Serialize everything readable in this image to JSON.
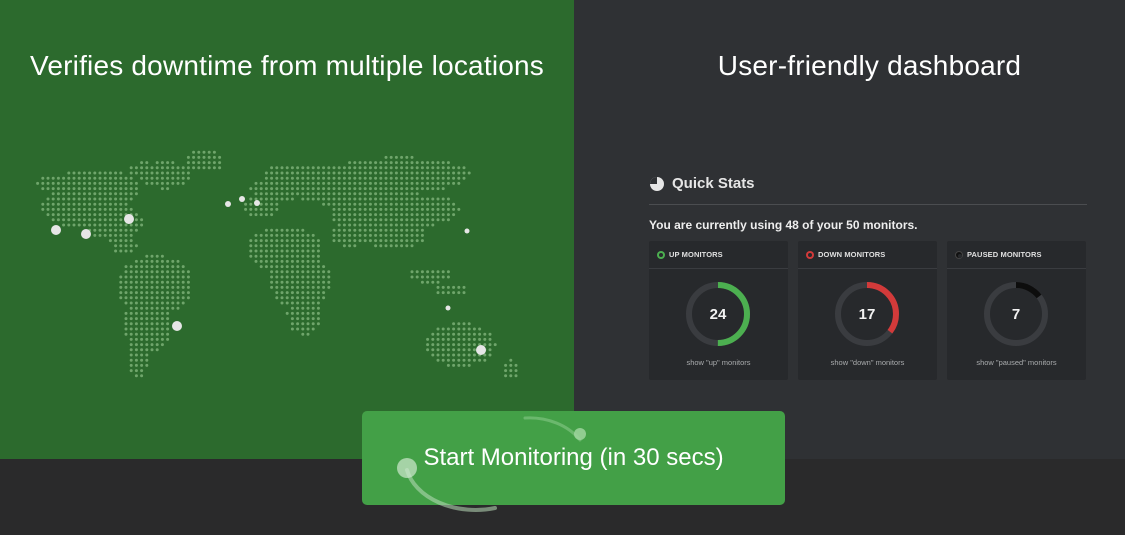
{
  "left_panel": {
    "title": "Verifies downtime from multiple locations",
    "colors": {
      "background": "#2c6a2d",
      "map_dots": "#6fa56b",
      "location_markers": "#e6e6e6"
    }
  },
  "right_panel": {
    "title": "User-friendly dashboard",
    "quick_stats": {
      "title": "Quick Stats",
      "icon": "pie-chart-icon",
      "usage_text": "You are currently using 48 of your 50 monitors.",
      "cards": [
        {
          "key": "up",
          "label": "UP MONITORS",
          "value": "24",
          "link": "show \"up\" monitors",
          "color": "#4caf50",
          "fraction": 0.5
        },
        {
          "key": "down",
          "label": "DOWN MONITORS",
          "value": "17",
          "link": "show \"down\" monitors",
          "color": "#d23a3a",
          "fraction": 0.354
        },
        {
          "key": "paused",
          "label": "PAUSED MONITORS",
          "value": "7",
          "link": "show \"paused\" monitors",
          "color": "#0d0d0d",
          "fraction": 0.146
        }
      ]
    }
  },
  "cta": {
    "label": "Start Monitoring (in 30 secs)",
    "color": "#43a047"
  }
}
